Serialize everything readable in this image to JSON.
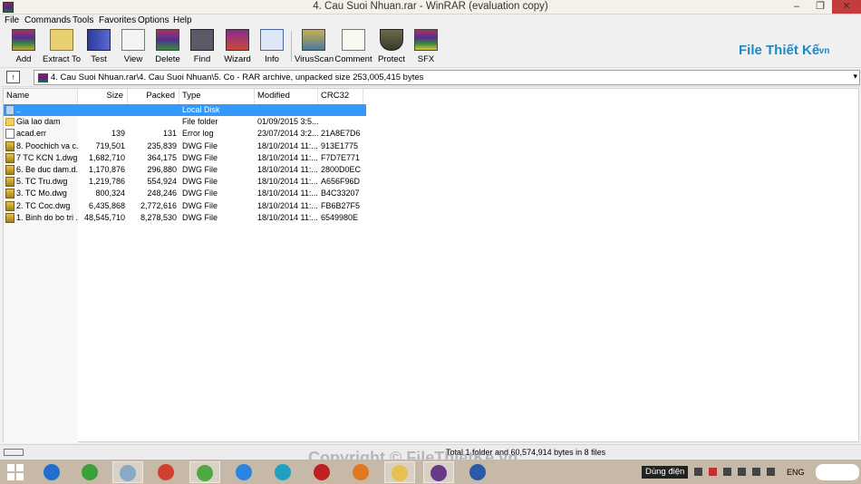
{
  "window": {
    "title": "4. Cau Suoi Nhuan.rar - WinRAR (evaluation copy)",
    "min": "–",
    "max": "❐",
    "close": "✕"
  },
  "menu": [
    "File",
    "Commands",
    "Tools",
    "Favorites",
    "Options",
    "Help"
  ],
  "toolbar": [
    {
      "label": "Add",
      "icon": "add-archive-icon"
    },
    {
      "label": "Extract To",
      "icon": "extract-folder-icon"
    },
    {
      "label": "Test",
      "icon": "test-book-icon"
    },
    {
      "label": "View",
      "icon": "view-glasses-icon"
    },
    {
      "label": "Delete",
      "icon": "delete-icon"
    },
    {
      "label": "Find",
      "icon": "find-binoculars-icon"
    },
    {
      "label": "Wizard",
      "icon": "wizard-icon"
    },
    {
      "label": "Info",
      "icon": "info-icon"
    },
    {
      "label": "VirusScan",
      "icon": "virus-scan-icon"
    },
    {
      "label": "Comment",
      "icon": "comment-icon"
    },
    {
      "label": "Protect",
      "icon": "protect-shield-icon"
    },
    {
      "label": "SFX",
      "icon": "sfx-icon"
    }
  ],
  "brand": {
    "part1": "File",
    "part2": "Thiết Kế",
    "part3": ".vn"
  },
  "address": {
    "path": "4. Cau Suoi Nhuan.rar\\4. Cau Suoi Nhuan\\5. Co - RAR archive, unpacked size 253,005,415 bytes",
    "dropdown": "▾",
    "up": "↑"
  },
  "columns": [
    "Name",
    "Size",
    "Packed",
    "Type",
    "Modified",
    "CRC32"
  ],
  "files": [
    {
      "name": "..",
      "size": "",
      "packed": "",
      "type": "Local Disk",
      "modified": "",
      "crc": "",
      "icon": "up"
    },
    {
      "name": "Gia lao dam",
      "size": "",
      "packed": "",
      "type": "File folder",
      "modified": "01/09/2015 3:5...",
      "crc": "",
      "icon": "folder"
    },
    {
      "name": "acad.err",
      "size": "139",
      "packed": "131",
      "type": "Error log",
      "modified": "23/07/2014 3:2...",
      "crc": "21A8E7D6",
      "icon": "log"
    },
    {
      "name": "8. Poochich va c...",
      "size": "719,501",
      "packed": "235,839",
      "type": "DWG File",
      "modified": "18/10/2014 11:...",
      "crc": "913E1775",
      "icon": "dwg"
    },
    {
      "name": "7 TC KCN 1.dwg",
      "size": "1,682,710",
      "packed": "364,175",
      "type": "DWG File",
      "modified": "18/10/2014 11:...",
      "crc": "F7D7E771",
      "icon": "dwg"
    },
    {
      "name": "6. Be duc dam.d...",
      "size": "1,170,876",
      "packed": "296,880",
      "type": "DWG File",
      "modified": "18/10/2014 11:...",
      "crc": "2800D0EC",
      "icon": "dwg"
    },
    {
      "name": "5. TC Tru.dwg",
      "size": "1,219,786",
      "packed": "554,924",
      "type": "DWG File",
      "modified": "18/10/2014 11:...",
      "crc": "A656F96D",
      "icon": "dwg"
    },
    {
      "name": "3. TC Mo.dwg",
      "size": "800,324",
      "packed": "248,246",
      "type": "DWG File",
      "modified": "18/10/2014 11:...",
      "crc": "B4C33207",
      "icon": "dwg"
    },
    {
      "name": "2. TC Coc.dwg",
      "size": "6,435,868",
      "packed": "2,772,616",
      "type": "DWG File",
      "modified": "18/10/2014 11:...",
      "crc": "FB6B27F5",
      "icon": "dwg"
    },
    {
      "name": "1. Binh do bo tri ...",
      "size": "48,545,710",
      "packed": "8,278,530",
      "type": "DWG File",
      "modified": "18/10/2014 11:...",
      "crc": "6549980E",
      "icon": "dwg"
    }
  ],
  "status": "Total 1 folder and 60,574,914 bytes in 8 files",
  "watermark": "Copyright © FileThietKe.vn",
  "taskbar": {
    "apps": [
      {
        "icon": "internet-explorer-icon",
        "color": "#1e6fd0"
      },
      {
        "icon": "utorrent-icon",
        "color": "#3aa03a"
      },
      {
        "icon": "pinned-app-icon",
        "color": "#8aa8c8"
      },
      {
        "icon": "chrome-icon",
        "color": "#d04030"
      },
      {
        "icon": "coccoc-icon",
        "color": "#4caa40"
      },
      {
        "icon": "zalo-icon",
        "color": "#2b84e0"
      },
      {
        "icon": "p-app-icon",
        "color": "#20a0c0"
      },
      {
        "icon": "autocad-icon",
        "color": "#c02020"
      },
      {
        "icon": "g-app-icon",
        "color": "#e07820"
      },
      {
        "icon": "file-explorer-icon",
        "color": "#e8c050"
      },
      {
        "icon": "winrar-icon",
        "color": "#6a3a8a"
      },
      {
        "icon": "word-icon",
        "color": "#2a5aa8"
      }
    ],
    "lang": "Dùng điện",
    "eng": "ENG"
  }
}
